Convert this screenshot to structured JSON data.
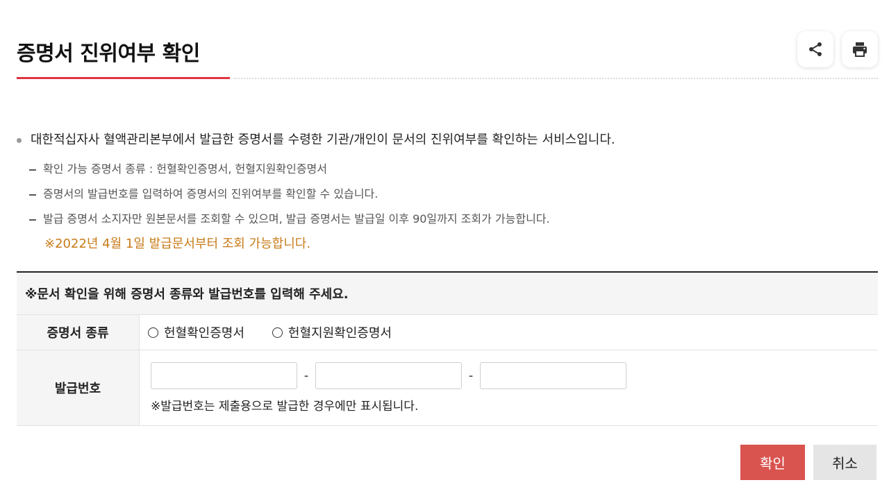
{
  "header": {
    "title": "증명서 진위여부 확인",
    "share_icon": "share-icon",
    "print_icon": "print-icon"
  },
  "intro": {
    "main": "대한적십자사 혈액관리본부에서 발급한 증명서를 수령한 기관/개인이 문서의 진위여부를 확인하는 서비스입니다.",
    "items": [
      "확인 가능 증명서 종류 : 헌혈확인증명서, 헌혈지원확인증명서",
      "증명서의 발급번호를 입력하여 증명서의 진위여부를 확인할 수 있습니다.",
      "발급 증명서 소지자만 원본문서를 조회할 수 있으며, 발급 증명서는 발급일 이후 90일까지 조회가 가능합니다."
    ],
    "notice": "※2022년 4월 1일 발급문서부터 조회 가능합니다."
  },
  "form": {
    "heading": "※문서 확인을 위해 증명서 종류와 발급번호를 입력해 주세요.",
    "type_label": "증명서 종류",
    "type_options": [
      "헌혈확인증명서",
      "헌혈지원확인증명서"
    ],
    "number_label": "발급번호",
    "number_separator": "-",
    "number_values": [
      "",
      "",
      ""
    ],
    "number_note": "※발급번호는 제출용으로 발급한 경우에만 표시됩니다."
  },
  "actions": {
    "confirm_label": "확인",
    "cancel_label": "취소"
  },
  "colors": {
    "accent_red": "#e0333f",
    "confirm_button": "#d9534f",
    "notice_orange": "#c87a17"
  }
}
